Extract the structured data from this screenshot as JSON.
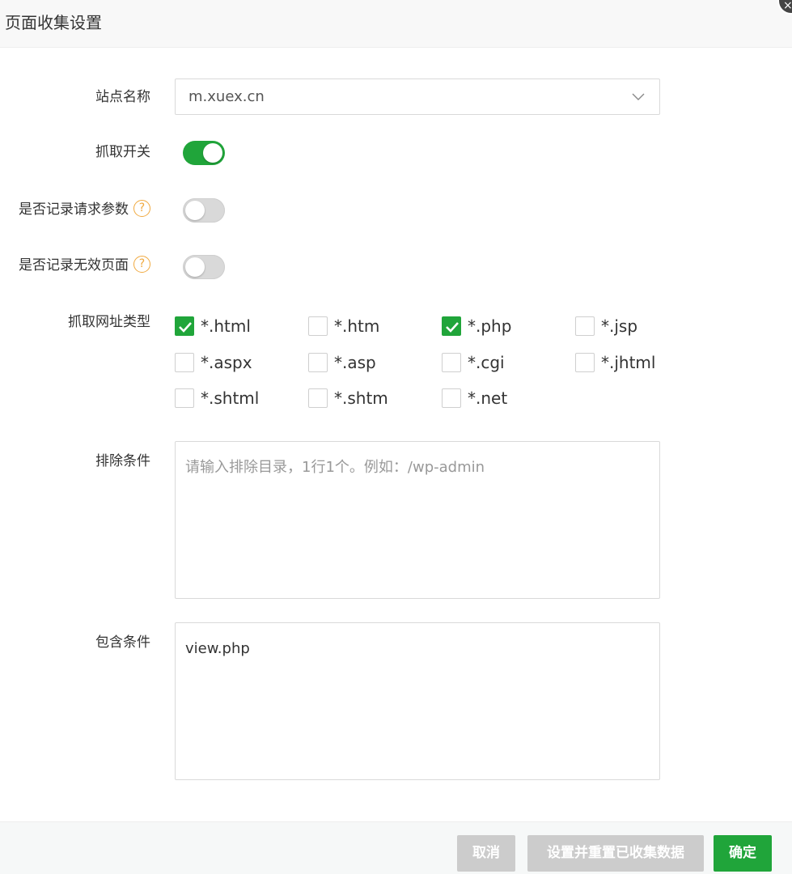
{
  "dialog": {
    "title": "页面收集设置",
    "close_symbol": "×"
  },
  "form": {
    "site_name": {
      "label": "站点名称",
      "selected": "m.xuex.cn",
      "icon": "chevron-down-icon"
    },
    "crawl_switch": {
      "label": "抓取开关",
      "on": true
    },
    "record_params": {
      "label": "是否记录请求参数",
      "help": "?",
      "on": false
    },
    "record_invalid": {
      "label": "是否记录无效页面",
      "help": "?",
      "on": false
    },
    "url_types": {
      "label": "抓取网址类型",
      "options": [
        {
          "label": "*.html",
          "checked": true
        },
        {
          "label": "*.htm",
          "checked": false
        },
        {
          "label": "*.php",
          "checked": true
        },
        {
          "label": "*.jsp",
          "checked": false
        },
        {
          "label": "*.aspx",
          "checked": false
        },
        {
          "label": "*.asp",
          "checked": false
        },
        {
          "label": "*.cgi",
          "checked": false
        },
        {
          "label": "*.jhtml",
          "checked": false
        },
        {
          "label": "*.shtml",
          "checked": false
        },
        {
          "label": "*.shtm",
          "checked": false
        },
        {
          "label": "*.net",
          "checked": false
        }
      ]
    },
    "exclude": {
      "label": "排除条件",
      "placeholder": "请输入排除目录，1行1个。例如：/wp-admin",
      "value": ""
    },
    "include": {
      "label": "包含条件",
      "placeholder": "",
      "value": "view.php"
    }
  },
  "footer": {
    "cancel_label": "取消",
    "reset_label": "设置并重置已收集数据",
    "confirm_label": "确定"
  },
  "colors": {
    "accent": "#20a53a",
    "help": "#f0a93f",
    "disabled_button": "#cccccc"
  }
}
